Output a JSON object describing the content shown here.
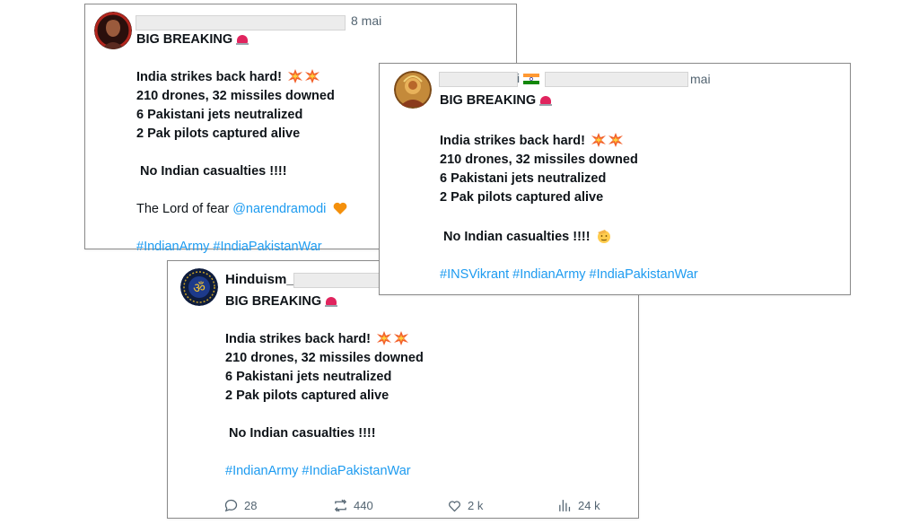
{
  "posts": [
    {
      "date": "8 mai",
      "headline": "BIG BREAKING",
      "lines": [
        "India strikes back hard!",
        "210 drones, 32 missiles downed",
        "6 Pakistani jets neutralized",
        "2 Pak pilots captured alive"
      ],
      "casualties": "No Indian casualties !!!!",
      "extra_text": "The Lord of fear",
      "mention": "@narendramodi",
      "hashtags": "#IndianArmy #IndiaPakistanWar"
    },
    {
      "date": "mai",
      "name_fragment": "i",
      "headline": "BIG BREAKING",
      "lines": [
        "India strikes back hard!",
        "210 drones, 32 missiles downed",
        "6 Pakistani jets neutralized",
        "2 Pak pilots captured alive"
      ],
      "casualties": "No Indian casualties !!!!",
      "hashtags": "#INSVikrant #IndianArmy #IndiaPakistanWar"
    },
    {
      "name": "Hinduism_",
      "headline": "BIG BREAKING",
      "lines": [
        "India strikes back hard!",
        "210 drones, 32 missiles downed",
        "6 Pakistani jets neutralized",
        "2 Pak pilots captured alive"
      ],
      "casualties": "No Indian casualties !!!!",
      "hashtags": "#IndianArmy #IndiaPakistanWar",
      "stats": {
        "replies": "28",
        "reposts": "440",
        "likes": "2 k",
        "views": "24 k"
      }
    }
  ],
  "icons": [
    "siren-emoji",
    "collision-emoji",
    "orange-heart-emoji",
    "saluting-face-emoji",
    "india-flag",
    "reply-icon",
    "repost-icon",
    "like-icon",
    "views-icon"
  ],
  "colors": {
    "link": "#1d9bf0",
    "text": "#0f1419",
    "muted": "#536471"
  }
}
